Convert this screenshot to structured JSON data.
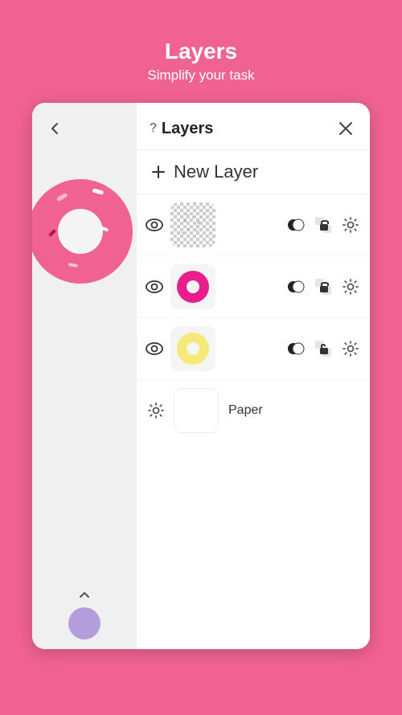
{
  "header": {
    "title": "Layers",
    "subtitle": "Simplify your task"
  },
  "layers_panel": {
    "title": "Layers",
    "help_label": "?",
    "new_layer_label": "New Layer",
    "paper_label": "Paper",
    "layers": [
      {
        "id": "layer-1",
        "visible": true,
        "type": "dots"
      },
      {
        "id": "layer-2",
        "visible": true,
        "type": "donut-pink"
      },
      {
        "id": "layer-3",
        "visible": true,
        "type": "donut-yellow"
      }
    ]
  }
}
